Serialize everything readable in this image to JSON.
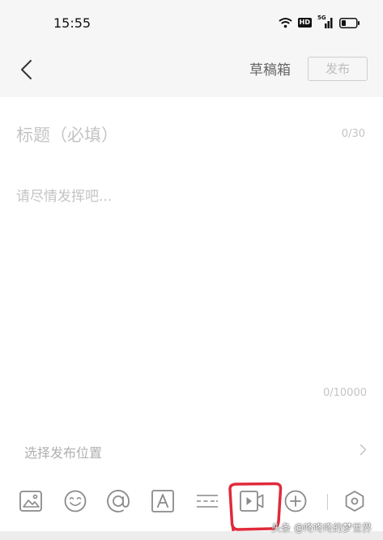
{
  "status_bar": {
    "time": "15:55",
    "hd_label": "HD",
    "network_label": "5G"
  },
  "header": {
    "drafts_label": "草稿箱",
    "publish_label": "发布"
  },
  "editor": {
    "title_placeholder": "标题（必填）",
    "title_counter": "0/30",
    "body_placeholder": "请尽情发挥吧...",
    "body_counter": "0/10000"
  },
  "location": {
    "label": "选择发布位置"
  },
  "toolbar": {
    "items": [
      "image-icon",
      "emoji-icon",
      "mention-icon",
      "text-format-icon",
      "divider-line-icon",
      "video-icon",
      "add-icon",
      "settings-icon"
    ],
    "highlight_color": "#e02a3b"
  },
  "watermark": {
    "text": "头条 @咚咚咚的梦世界"
  },
  "colors": {
    "header_bg": "#f6f6f6",
    "placeholder": "#c4c4c4",
    "icon": "#8a8a8a"
  }
}
